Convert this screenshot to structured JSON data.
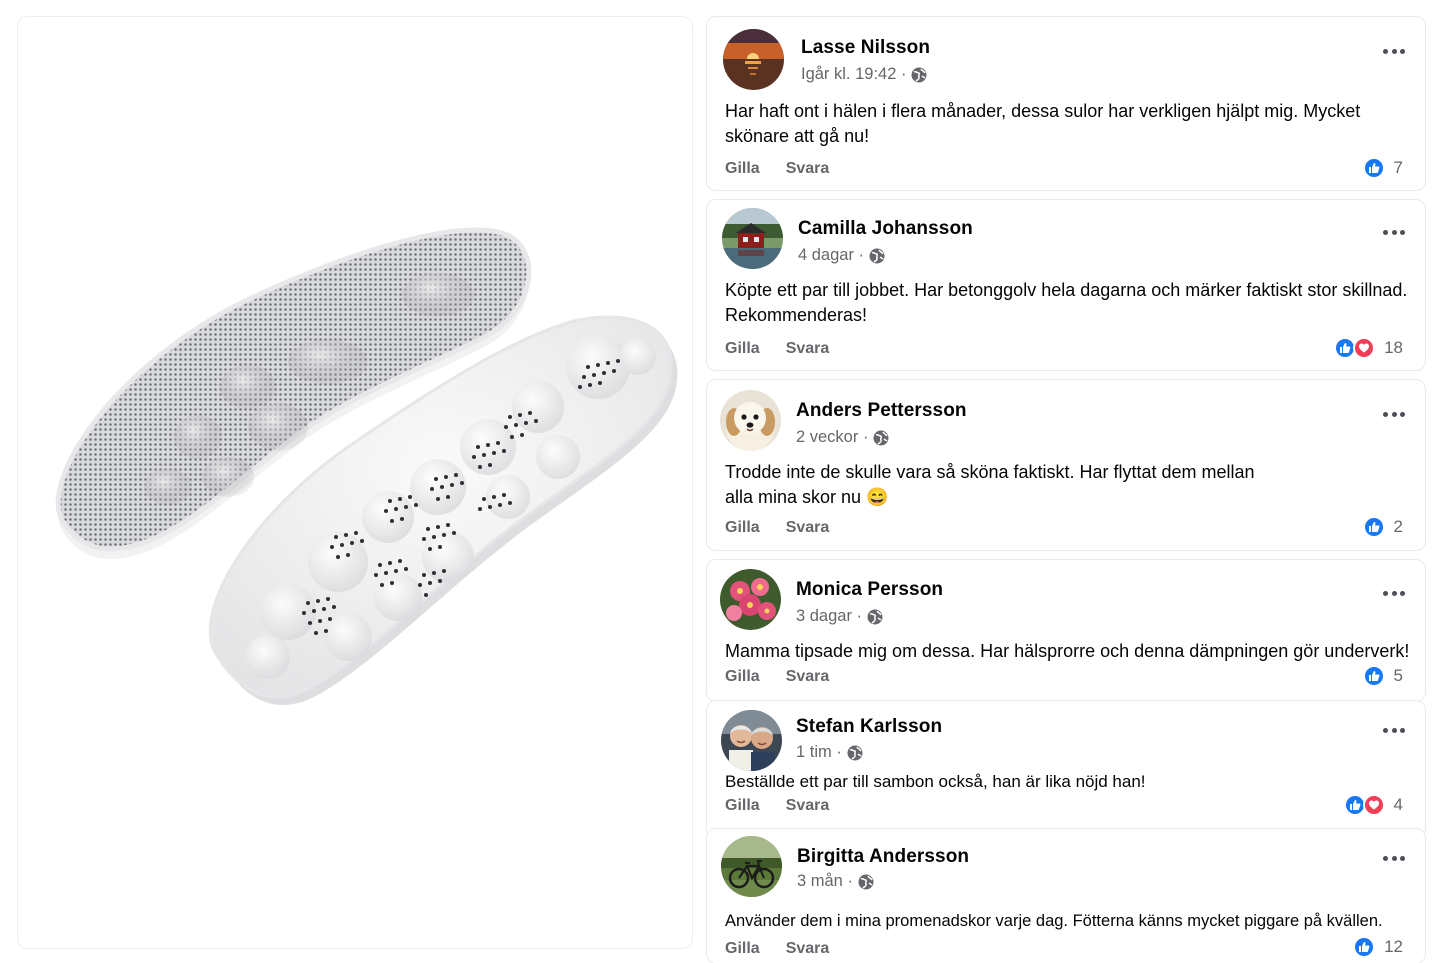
{
  "product": {
    "image_name": "insoles-product-photo"
  },
  "comments": [
    {
      "name": "Lasse Nilsson",
      "time": "Igår kl. 19:42 ·",
      "text": "Har haft ont i hälen i flera månader, dessa sulor har verkligen hjälpt mig. Mycket skönare att gå nu!",
      "like_label": "Gilla",
      "reply_label": "Svara",
      "reaction_count": "7",
      "reactions": [
        "like"
      ],
      "avatar": "sunset-avatar"
    },
    {
      "name": "Camilla Johansson",
      "time": "4 dagar ·",
      "text": "Köpte ett par till jobbet. Har betonggolv hela dagarna och märker faktiskt stor skillnad. Rekommenderas!",
      "like_label": "Gilla",
      "reply_label": "Svara",
      "reaction_count": "18",
      "reactions": [
        "like",
        "love"
      ],
      "avatar": "red-cabin-avatar"
    },
    {
      "name": "Anders Pettersson",
      "time": "2 veckor ·",
      "text": "Trodde inte de skulle vara så sköna faktiskt. Har flyttat dem mellan alla mina skor nu 😄",
      "like_label": "Gilla",
      "reply_label": "Svara",
      "reaction_count": "2",
      "reactions": [
        "like"
      ],
      "avatar": "dog-avatar"
    },
    {
      "name": "Monica Persson",
      "time": "3 dagar ·",
      "text": "Mamma tipsade mig om dessa. Har hälsprorre och denna dämpningen gör underverk!",
      "like_label": "Gilla",
      "reply_label": "Svara",
      "reaction_count": "5",
      "reactions": [
        "like"
      ],
      "avatar": "pink-flowers-avatar"
    },
    {
      "name": "Stefan Karlsson",
      "time": "1 tim ·",
      "text": "Beställde ett par till sambon också, han är lika nöjd han!",
      "like_label": "Gilla",
      "reply_label": "Svara",
      "reaction_count": "4",
      "reactions": [
        "like",
        "love"
      ],
      "avatar": "couple-avatar"
    },
    {
      "name": "Birgitta Andersson",
      "time": "3 mån ·",
      "text": "Använder dem i mina promenadskor varje dag. Fötterna känns mycket piggare på kvällen.",
      "like_label": "Gilla",
      "reply_label": "Svara",
      "reaction_count": "12",
      "reactions": [
        "like"
      ],
      "avatar": "bicycle-avatar"
    }
  ],
  "colors": {
    "like_blue": "#1877f2",
    "love_red": "#f33e58",
    "secondary_text": "#65676b"
  }
}
